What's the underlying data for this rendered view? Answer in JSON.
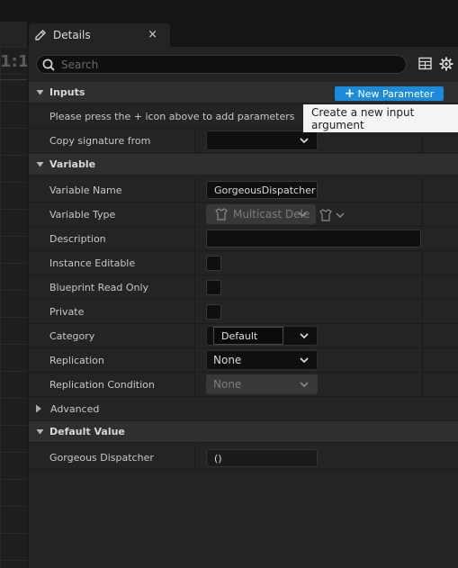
{
  "graph": {
    "zoom_label": "1:1"
  },
  "tab": {
    "title": "Details",
    "close": "×",
    "icon": "pencil-icon"
  },
  "search": {
    "placeholder": "Search"
  },
  "toolbar": {
    "table_icon": "table-view-icon",
    "settings_icon": "gear-icon"
  },
  "inputs": {
    "header": "Inputs",
    "new_param_label": "New Parameter",
    "tooltip": "Create a new input argument",
    "hint": "Please press the + icon above to add parameters",
    "copy_signature_label": "Copy signature from",
    "copy_signature_value": ""
  },
  "variable": {
    "header": "Variable",
    "rows": {
      "name_label": "Variable Name",
      "name_value": "GorgeousDispatcher",
      "type_label": "Variable Type",
      "type_value": "Multicast Dele",
      "description_label": "Description",
      "description_value": "",
      "instance_editable_label": "Instance Editable",
      "blueprint_read_only_label": "Blueprint Read Only",
      "private_label": "Private",
      "category_label": "Category",
      "category_value": "Default",
      "replication_label": "Replication",
      "replication_value": "None",
      "replication_condition_label": "Replication Condition",
      "replication_condition_value": "None"
    }
  },
  "advanced": {
    "label": "Advanced"
  },
  "default_value": {
    "header": "Default Value",
    "gorgeous_label": "Gorgeous Dispatcher",
    "gorgeous_value": "()"
  }
}
